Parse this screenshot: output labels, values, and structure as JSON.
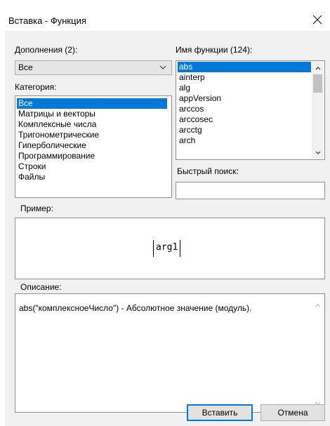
{
  "window": {
    "title": "Вставка - Функция",
    "close_icon": "close-icon"
  },
  "addons": {
    "label": "Дополнения (2):",
    "selected": "Все"
  },
  "category": {
    "label": "Категория:",
    "items": [
      "Все",
      "Матрицы и векторы",
      "Комплексные числа",
      "Тригонометрические",
      "Гиперболические",
      "Программирование",
      "Строки",
      "Файлы"
    ],
    "selected_index": 0
  },
  "function_name": {
    "label": "Имя функции (124):",
    "items": [
      "abs",
      "ainterp",
      "alg",
      "appVersion",
      "arccos",
      "arccosec",
      "arcctg",
      "arch"
    ],
    "selected_index": 0
  },
  "quick_search": {
    "label": "Быстрый поиск:",
    "value": ""
  },
  "example": {
    "label": "Пример:",
    "expression": "arg1"
  },
  "description": {
    "label": "Описание:",
    "text": "abs(\"комплексноеЧисло\") - Абсолютное значение (модуль)."
  },
  "buttons": {
    "insert": "Вставить",
    "cancel": "Отмена"
  },
  "colors": {
    "selection": "#0078d7",
    "dialog_bg": "#f0f0f0",
    "default_button_border": "#0078d7"
  }
}
